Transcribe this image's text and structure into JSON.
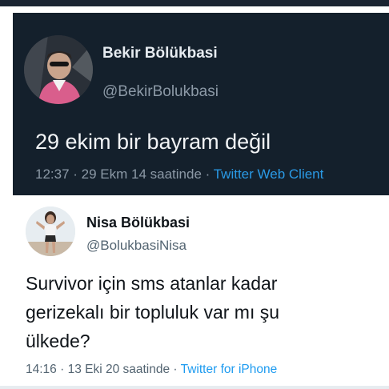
{
  "tweet_dark": {
    "display_name": "Bekir Bölükbasi",
    "handle": "@BekirBolukbasi",
    "text": "29 ekim bir bayram değil",
    "time": "12:37",
    "date": "29 Ekm 14 saatinde",
    "source": "Twitter Web Client",
    "separator": " · "
  },
  "tweet_light": {
    "display_name": "Nisa Bölükbasi",
    "handle": "@BolukbasiNisa",
    "text_lines": [
      "Survivor için sms atanlar kadar",
      "gerizekalı bir topluluk var mı şu",
      "ülkede?"
    ],
    "time": "14:16",
    "date": "13 Eki 20 saatinde",
    "source": "Twitter for iPhone",
    "separator": " · "
  },
  "colors": {
    "dark_bg": "#14202c",
    "dark_name": "#e6ebf0",
    "dark_muted": "#8c99a6",
    "light_text": "#0f1419",
    "light_muted": "#536471",
    "link_blue": "#1d9bf0"
  },
  "icons": {
    "dark_avatar": "profile-photo-man-in-car",
    "light_avatar": "profile-photo-woman-posing"
  }
}
